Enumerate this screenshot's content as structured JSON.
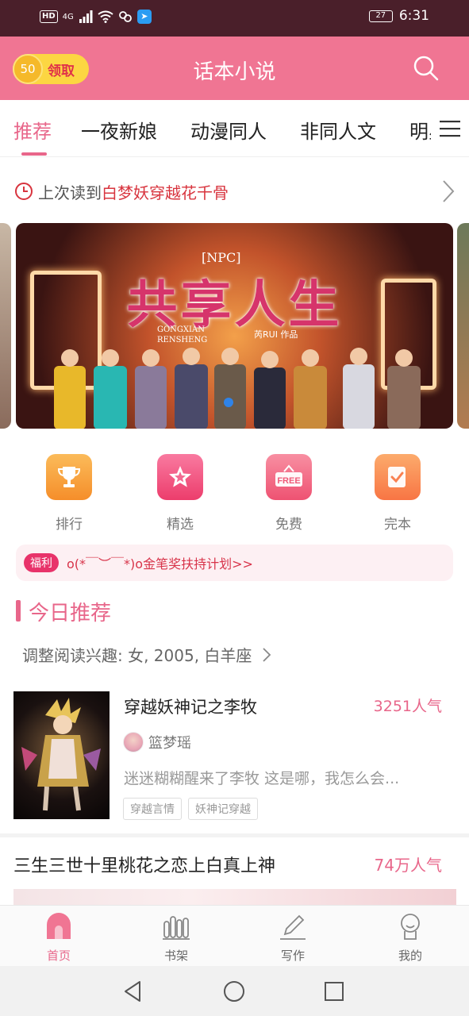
{
  "status_bar": {
    "hd": "HD",
    "network": "4G",
    "battery": "27",
    "time": "6:31"
  },
  "header": {
    "coin_amount": "50",
    "claim_label": "领取",
    "title": "话本小说",
    "search_icon": "search-icon"
  },
  "tabs": [
    {
      "label": "推荐",
      "active": true
    },
    {
      "label": "一夜新娘",
      "active": false
    },
    {
      "label": "动漫同人",
      "active": false
    },
    {
      "label": "非同人文",
      "active": false
    },
    {
      "label": "明星",
      "active": false
    }
  ],
  "last_read": {
    "prefix": "上次读到",
    "book": "白梦妖穿越花千骨"
  },
  "banner": {
    "tag": "[NPC]",
    "title": "共享人生",
    "pinyin_1": "GONGXIAN",
    "pinyin_2": "RENSHENG",
    "author": "芮RUI 作品"
  },
  "features": [
    {
      "label": "排行",
      "icon": "trophy-icon",
      "color": "#f7a13c"
    },
    {
      "label": "精选",
      "icon": "star-icon",
      "color": "#f0557c"
    },
    {
      "label": "免费",
      "icon": "free-tag-icon",
      "color": "#f26d86"
    },
    {
      "label": "完本",
      "icon": "checkbook-icon",
      "color": "#fa8b4c"
    }
  ],
  "welfare": {
    "badge": "福利",
    "text": "o(*￣︶￣*)o金笔奖扶持计划>>"
  },
  "today": {
    "title": "今日推荐",
    "interest": "调整阅读兴趣: 女, 2005, 白羊座"
  },
  "books": [
    {
      "title": "穿越妖神记之李牧",
      "popularity": "3251人气",
      "author": "篮梦瑶",
      "description": "迷迷糊糊醒来了李牧 这是哪，我怎么会...",
      "tags": [
        "穿越言情",
        "妖神记穿越"
      ]
    },
    {
      "title": "三生三世十里桃花之恋上白真上神",
      "popularity": "74万人气"
    }
  ],
  "bottom_nav": [
    {
      "label": "首页",
      "icon": "home-icon",
      "active": true
    },
    {
      "label": "书架",
      "icon": "bookshelf-icon",
      "active": false
    },
    {
      "label": "写作",
      "icon": "pencil-icon",
      "active": false
    },
    {
      "label": "我的",
      "icon": "profile-icon",
      "active": false
    }
  ],
  "colors": {
    "accent": "#e8668a",
    "header": "#f07593",
    "status_bar": "#4a1f2a"
  }
}
